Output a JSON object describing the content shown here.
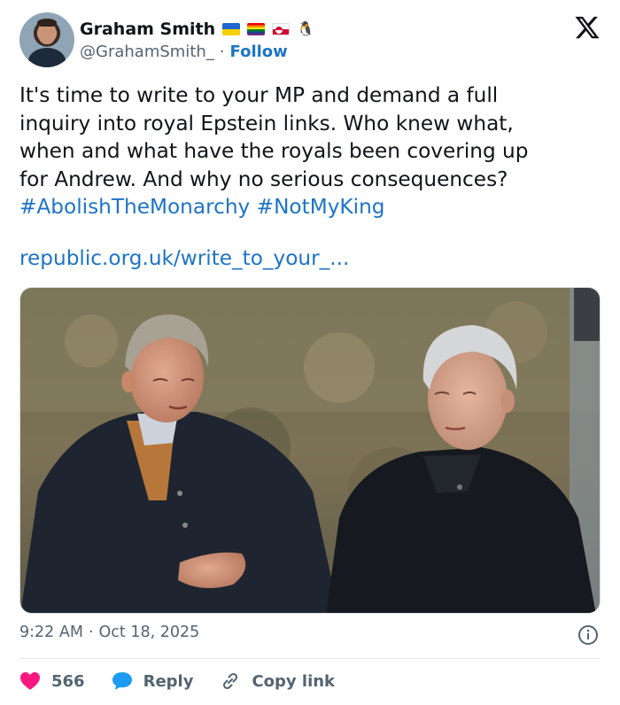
{
  "author": {
    "display_name": "Graham Smith",
    "handle": "@GrahamSmith_",
    "separator": "·",
    "follow_label": "Follow",
    "badges": [
      "ukraine-flag",
      "rainbow-flag",
      "greenland-flag",
      "penguin-emoji"
    ],
    "penguin_glyph": "🐧"
  },
  "tweet": {
    "lines": [
      "It's time to write to your MP and demand a full",
      "inquiry into royal Epstein links. Who knew what,",
      "when and what have the royals been covering up",
      "for Andrew. And why no serious consequences?"
    ],
    "hashtags": [
      "#AbolishTheMonarchy",
      "#NotMyKing"
    ],
    "link": "republic.org.uk/write_to_your_..."
  },
  "meta": {
    "time": "9:22 AM",
    "separator": "·",
    "date": "Oct 18, 2025"
  },
  "actions": {
    "likes": "566",
    "reply_label": "Reply",
    "copy_link_label": "Copy link"
  },
  "colors": {
    "accent": "#1d74c7",
    "heart": "#f91880",
    "reply_bubble": "#1d9bf0",
    "secondary_text": "#536471"
  }
}
